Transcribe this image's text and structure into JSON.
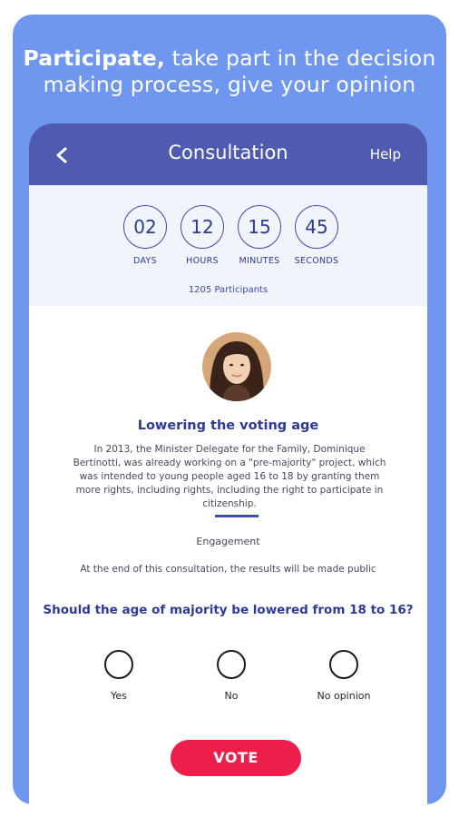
{
  "promo": {
    "headline_bold": "Participate,",
    "headline_line1_rest": " take part in the decision",
    "headline_line2": "making process, give your opinion",
    "background_color": "#6f97ef"
  },
  "app_bar": {
    "back_icon": "chevron-left-icon",
    "title": "Consultation",
    "help_label": "Help",
    "color": "#4e5bb0"
  },
  "countdown": {
    "units": [
      {
        "value": "02",
        "label": "DAYS"
      },
      {
        "value": "12",
        "label": "HOURS"
      },
      {
        "value": "15",
        "label": "MINUTES"
      },
      {
        "value": "45",
        "label": "SECONDS"
      }
    ],
    "participants": "1205 Participants"
  },
  "consultation": {
    "avatar": "portrait-photo",
    "title": "Lowering the voting age",
    "description": "In 2013, the Minister Delegate for the Family, Dominique Bertinotti, was already working on a \"pre-majority\" project, which was intended to young people aged 16 to 18 by granting them more rights, including rights, including the right to participate in citizenship.",
    "engagement_label": "Engagement",
    "engagement_note": "At the end of this consultation, the results will be made public"
  },
  "poll": {
    "question": "Should the age of majority be lowered from 18 to 16?",
    "options": [
      {
        "label": "Yes"
      },
      {
        "label": "No"
      },
      {
        "label": "No opinion"
      }
    ],
    "vote_label": "VOTE",
    "vote_color": "#ee1d4a"
  }
}
